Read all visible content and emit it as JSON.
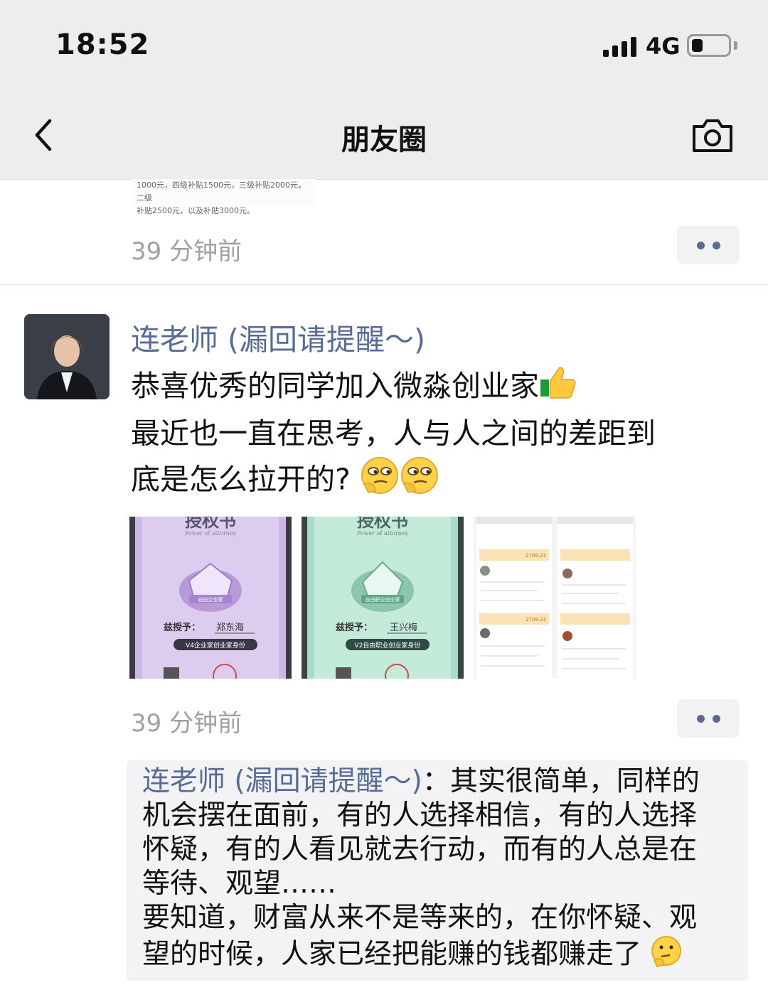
{
  "status_bar": {
    "time": "18:52",
    "network": "4G",
    "battery_level": 0.3
  },
  "nav": {
    "title": "朋友圈",
    "back_icon": "chevron-left-icon",
    "camera_icon": "camera-icon"
  },
  "previous_post": {
    "snippet_line1": "1000元，四级补贴1500元，三级补贴2000元，二级",
    "snippet_line2": "补贴2500元，以及补贴3000元。",
    "timestamp": "39 分钟前"
  },
  "post": {
    "author": "连老师 (漏回请提醒～)",
    "text_line1": "恭喜优秀的同学加入微淼创业家",
    "text_line2": "最近也一直在思考，人与人之间的差距到",
    "text_line3": "底是怎么拉开的?",
    "images": [
      {
        "header": "授权书",
        "subheader": "Power of attorney",
        "badge": "自由企业家",
        "grant_label": "兹授予：",
        "grantee": "郑东海",
        "role": "V4企业家创业家身份"
      },
      {
        "header": "授权书",
        "subheader": "Power of attorney",
        "badge": "自由职业创业家",
        "grant_label": "兹授予：",
        "grantee": "王兴梅",
        "role": "V2自由职业创业家身份"
      },
      {
        "amount1": "2709.21",
        "amount2": "2709.21"
      }
    ],
    "timestamp": "39 分钟前",
    "comment": {
      "author": "连老师 (漏回请提醒～)",
      "line1": "：其实很简单，同样的",
      "line2": "机会摆在面前，有的人选择相信，有的人选择",
      "line3": "怀疑，有的人看见就去行动，而有的人总是在",
      "line4": "等待、观望……",
      "line5": "要知道，财富从来不是等来的，在你怀疑、观",
      "line6": "望的时候，人家已经把能赚的钱都赚走了"
    }
  },
  "colors": {
    "link": "#576b95",
    "bar": "#ededed",
    "comment_bg": "#f3f3f5"
  }
}
